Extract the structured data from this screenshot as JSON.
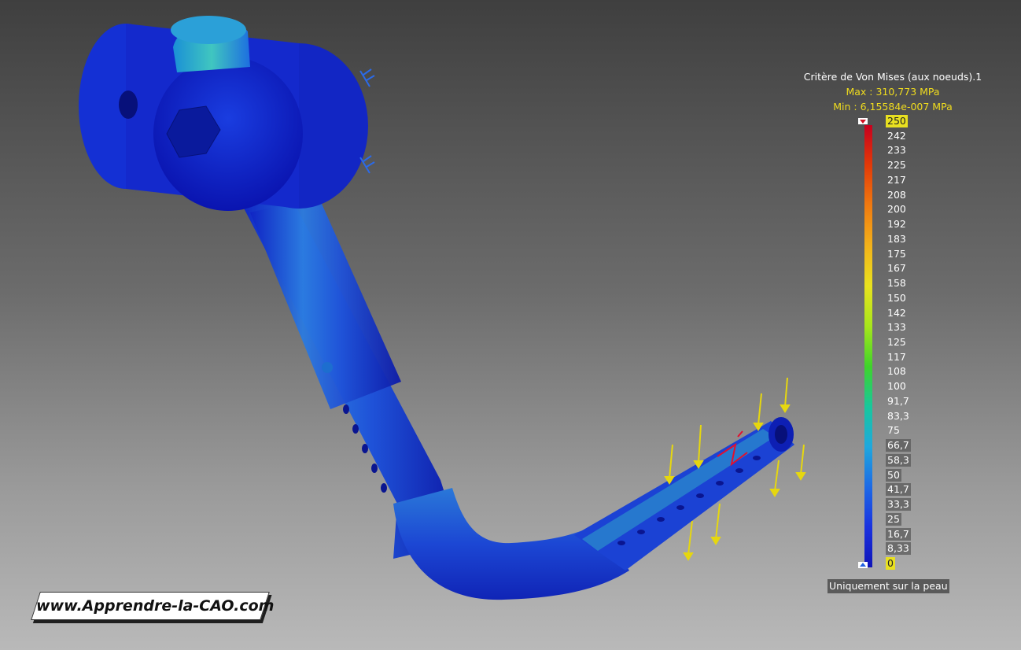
{
  "legend": {
    "title": "Critère de Von Mises (aux noeuds).1",
    "max": "Max : 310,773 MPa",
    "min": "Min : 6,15584e-007 MPa",
    "ticks": [
      "250",
      "242",
      "233",
      "225",
      "217",
      "208",
      "200",
      "192",
      "183",
      "175",
      "167",
      "158",
      "150",
      "142",
      "133",
      "125",
      "117",
      "108",
      "100",
      "91,7",
      "83,3",
      "75",
      "66,7",
      "58,3",
      "50",
      "41,7",
      "33,3",
      "25",
      "16,7",
      "8,33",
      "0"
    ],
    "skin_toggle": "Uniquement sur la peau"
  },
  "brand": {
    "text": "www.Apprendre-la-CAO.com"
  },
  "colors": {
    "scale": [
      "#c8001e",
      "#e23a08",
      "#f07a10",
      "#f3b21a",
      "#e9e21e",
      "#a7e61c",
      "#3fd32a",
      "#18c89c",
      "#1fa8de",
      "#1d6ae6",
      "#1a32e0",
      "#0f14b8"
    ],
    "part_base": "#1537d9",
    "force_arrow": "#e6d70f",
    "fixture": "#2b6ae8"
  }
}
